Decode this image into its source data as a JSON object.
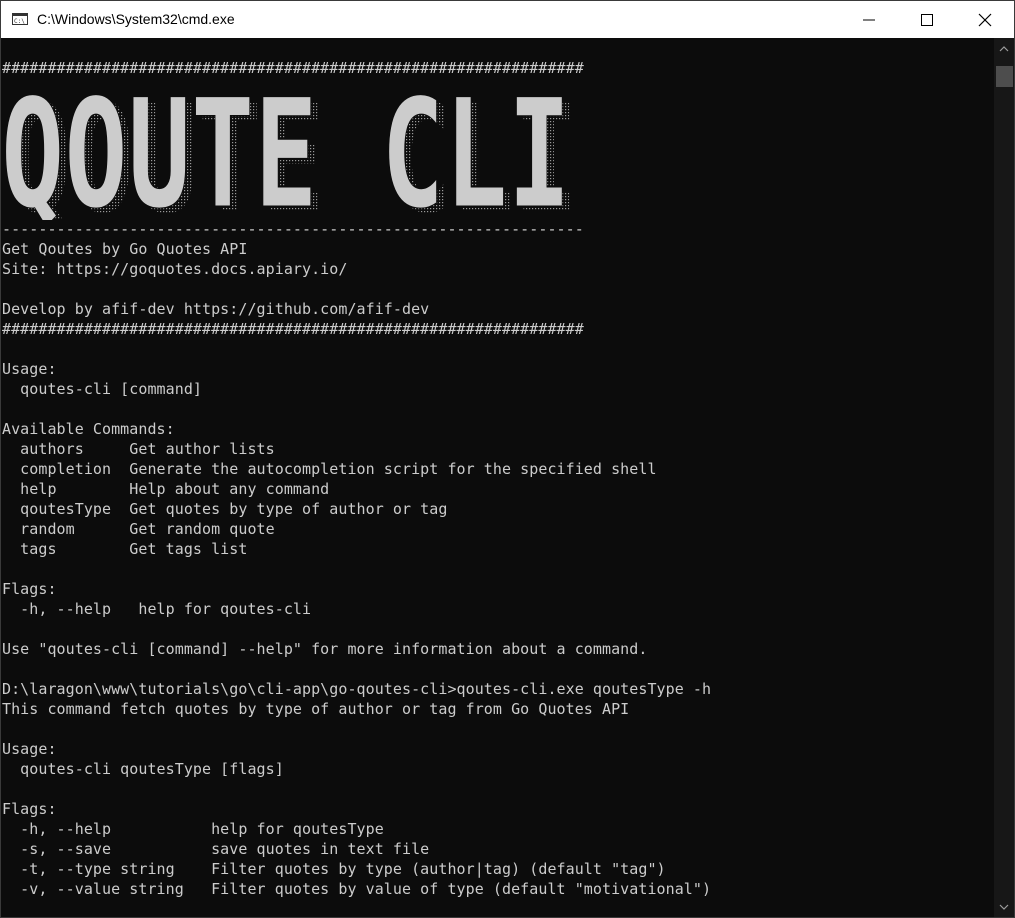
{
  "window": {
    "title": "C:\\Windows\\System32\\cmd.exe"
  },
  "banner": {
    "text": "QOUTE CLI",
    "fill_color": "#cccccc"
  },
  "console": {
    "lines": [
      "################################################################",
      "----------------------------------------------------------------",
      "Get Qoutes by Go Quotes API",
      "Site: https://goquotes.docs.apiary.io/",
      "",
      "Develop by afif-dev https://github.com/afif-dev",
      "################################################################",
      "",
      "Usage:",
      "  qoutes-cli [command]",
      "",
      "Available Commands:",
      "  authors     Get author lists",
      "  completion  Generate the autocompletion script for the specified shell",
      "  help        Help about any command",
      "  qoutesType  Get quotes by type of author or tag",
      "  random      Get random quote",
      "  tags        Get tags list",
      "",
      "Flags:",
      "  -h, --help   help for qoutes-cli",
      "",
      "Use \"qoutes-cli [command] --help\" for more information about a command.",
      "",
      "D:\\laragon\\www\\tutorials\\go\\cli-app\\go-qoutes-cli>qoutes-cli.exe qoutesType -h",
      "This command fetch quotes by type of author or tag from Go Quotes API",
      "",
      "Usage:",
      "  qoutes-cli qoutesType [flags]",
      "",
      "Flags:",
      "  -h, --help           help for qoutesType",
      "  -s, --save           save quotes in text file",
      "  -t, --type string    Filter quotes by type (author|tag) (default \"tag\")",
      "  -v, --value string   Filter quotes by value of type (default \"motivational\")"
    ]
  },
  "colors": {
    "background": "#0c0c0c",
    "text": "#cccccc",
    "titlebar": "#ffffff"
  }
}
